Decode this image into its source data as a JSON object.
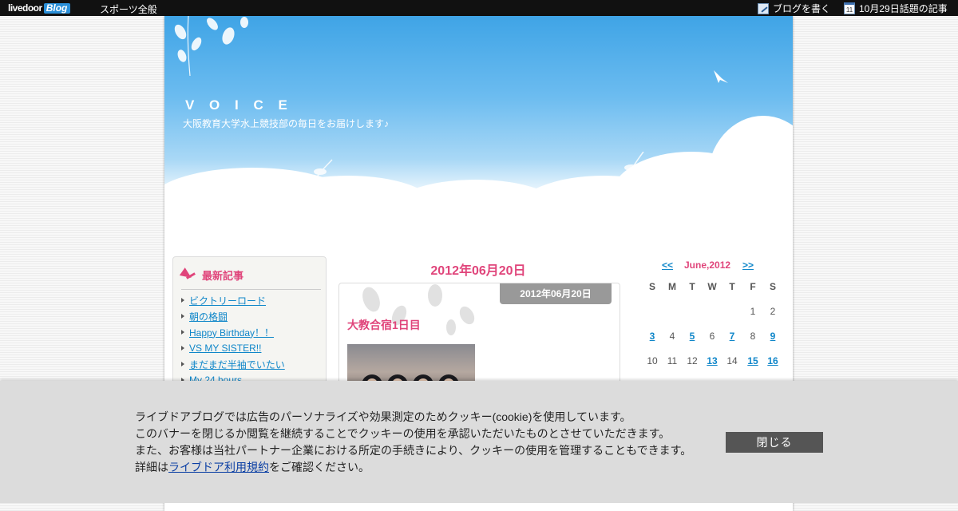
{
  "topbar": {
    "logo_text": "livedoor",
    "logo_blog": "Blog",
    "category": "スポーツ全般",
    "write_label": "ブログを書く",
    "calendar_icon_day": "11",
    "topic_label": "10月29日話題の記事"
  },
  "header": {
    "title": "V O I C E",
    "description": "大阪教育大学水上競技部の毎日をお届けします♪"
  },
  "sidebar": {
    "heading": "最新記事",
    "items": [
      {
        "label": "ビクトリーロード"
      },
      {
        "label": "朝の格闘"
      },
      {
        "label": "Happy Birthday！！"
      },
      {
        "label": "VS MY SISTER!!"
      },
      {
        "label": "まだまだ半袖でいたい"
      },
      {
        "label": "My 24 hours"
      }
    ]
  },
  "main": {
    "date_heading": "2012年06月20日",
    "post": {
      "date_badge": "2012年06月20日",
      "title": "大教合宿1日目"
    }
  },
  "calendar": {
    "prev": "<<",
    "next": ">>",
    "month": "June,2012",
    "dow": [
      "S",
      "M",
      "T",
      "W",
      "T",
      "F",
      "S"
    ],
    "rows": [
      [
        "",
        "",
        "",
        "",
        "",
        "1",
        "2"
      ],
      [
        "3",
        "4",
        "5",
        "6",
        "7",
        "8",
        "9"
      ],
      [
        "10",
        "11",
        "12",
        "13",
        "14",
        "15",
        "16"
      ]
    ],
    "linked": [
      "3",
      "5",
      "7",
      "9",
      "13",
      "15",
      "16"
    ]
  },
  "cookie": {
    "line1": "ライブドアブログでは広告のパーソナライズや効果測定のためクッキー(cookie)を使用しています。",
    "line2": "このバナーを閉じるか閲覧を継続することでクッキーの使用を承認いただいたものとさせていただきます。",
    "line3": "また、お客様は当社パートナー企業における所定の手続きにより、クッキーの使用を管理することもできます。",
    "line4_prefix": "詳細は",
    "line4_link": "ライブドア利用規約",
    "line4_suffix": "をご確認ください。",
    "close_label": "閉じる"
  }
}
